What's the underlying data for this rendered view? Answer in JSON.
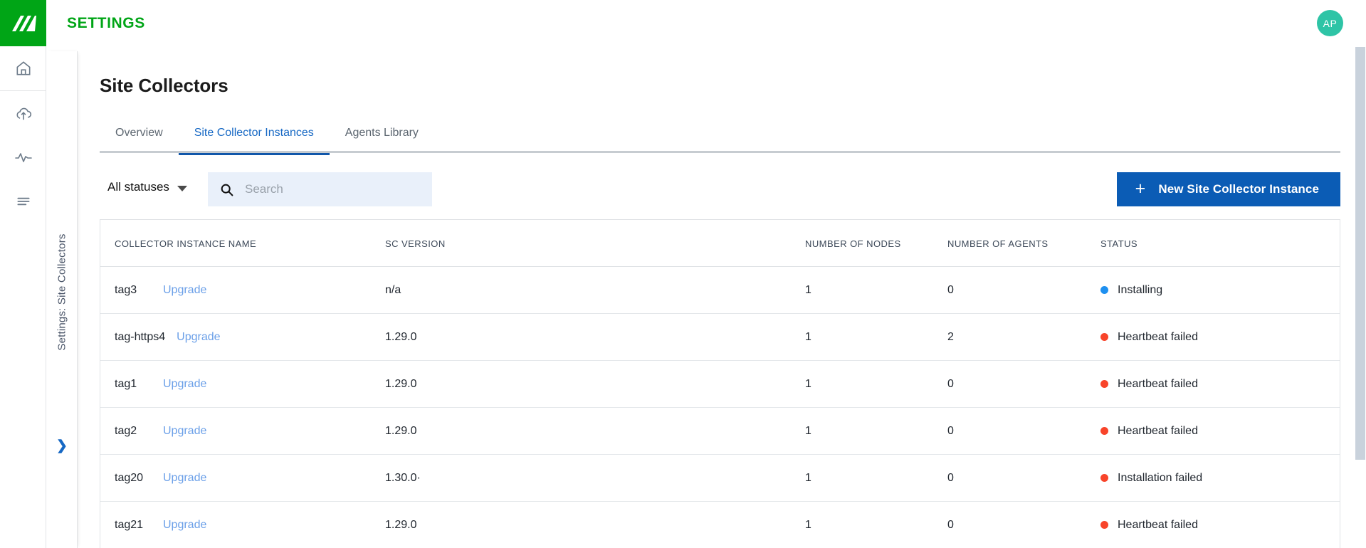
{
  "topbar": {
    "logo_icon": "tripwire-logo-icon",
    "title": "SETTINGS",
    "avatar_initials": "AP"
  },
  "rail": {
    "items": [
      {
        "icon": "home-icon",
        "name": "home"
      },
      {
        "icon": "cloud-upload-icon",
        "name": "cloud-upload"
      },
      {
        "icon": "activity-pulse-icon",
        "name": "activity"
      },
      {
        "icon": "list-lines-icon",
        "name": "reports"
      }
    ]
  },
  "vstrip": {
    "label": "Settings: Site Collectors",
    "chevron_icon": "chevron-right-icon"
  },
  "main": {
    "page_title": "Site Collectors",
    "tabs": [
      {
        "label": "Overview",
        "active": false
      },
      {
        "label": "Site Collector Instances",
        "active": true
      },
      {
        "label": "Agents Library",
        "active": false
      }
    ],
    "filter": {
      "status_label": "All statuses",
      "dropdown_icon": "caret-down-icon",
      "search_icon": "search-icon",
      "search_value": "",
      "search_placeholder": "Search"
    },
    "new_button": {
      "icon": "plus-icon",
      "label": "New Site Collector Instance"
    },
    "table": {
      "columns": [
        "COLLECTOR INSTANCE NAME",
        "SC VERSION",
        "NUMBER OF NODES",
        "NUMBER OF AGENTS",
        "STATUS"
      ],
      "upgrade_label": "Upgrade",
      "rows": [
        {
          "name": "tag3",
          "action": "Upgrade",
          "version": "n/a",
          "nodes": "1",
          "agents": "0",
          "status": "Installing",
          "status_color": "#1e90f0"
        },
        {
          "name": "tag-https4",
          "action": "Upgrade",
          "version": "1.29.0",
          "nodes": "1",
          "agents": "2",
          "status": "Heartbeat failed",
          "status_color": "#f8442a"
        },
        {
          "name": "tag1",
          "action": "Upgrade",
          "version": "1.29.0",
          "nodes": "1",
          "agents": "0",
          "status": "Heartbeat failed",
          "status_color": "#f8442a"
        },
        {
          "name": "tag2",
          "action": "Upgrade",
          "version": "1.29.0",
          "nodes": "1",
          "agents": "0",
          "status": "Heartbeat failed",
          "status_color": "#f8442a"
        },
        {
          "name": "tag20",
          "action": "Upgrade",
          "version": "1.30.0·",
          "nodes": "1",
          "agents": "0",
          "status": "Installation failed",
          "status_color": "#f8442a"
        },
        {
          "name": "tag21",
          "action": "Upgrade",
          "version": "1.29.0",
          "nodes": "1",
          "agents": "0",
          "status": "Heartbeat failed",
          "status_color": "#f8442a"
        }
      ]
    }
  },
  "colors": {
    "brand_green": "#00a516",
    "accent_blue": "#1668c4",
    "button_blue": "#0b5cb5",
    "link_blue": "#6a9fe8",
    "avatar_teal": "#2ec4a6",
    "status_blue": "#1e90f0",
    "status_red": "#f8442a",
    "search_bg": "#e9f0fa"
  }
}
